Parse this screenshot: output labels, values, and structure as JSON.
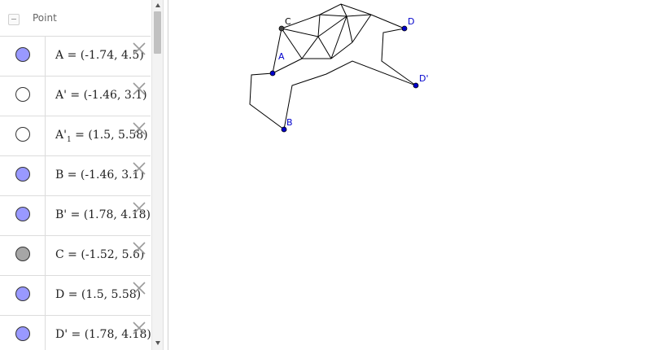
{
  "algebra": {
    "group_title": "Point",
    "items": [
      {
        "name": "A",
        "value": "= (-1.74, 4.5)",
        "color": "#9999ff"
      },
      {
        "name": "A'",
        "value": "= (-1.46, 3.1)",
        "color": "#ffffff"
      },
      {
        "name": "A'",
        "sub": "1",
        "value": "= (1.5, 5.58)",
        "color": "#ffffff"
      },
      {
        "name": "B",
        "value": "= (-1.46, 3.1)",
        "color": "#9999ff"
      },
      {
        "name": "B'",
        "value": "= (1.78, 4.18)",
        "color": "#9999ff"
      },
      {
        "name": "C",
        "value": "= (-1.52, 5.6)",
        "color": "#a6a6a6"
      },
      {
        "name": "D",
        "value": "= (1.5, 5.58)",
        "color": "#9999ff"
      },
      {
        "name": "D'",
        "value": "= (1.78, 4.18)",
        "color": "#9999ff"
      }
    ]
  },
  "graphics": {
    "point_color": "#0000cc",
    "label_color": "#0000cc",
    "labels": {
      "C": "C",
      "A": "A",
      "B": "B",
      "D": "D",
      "Dp": "D'"
    }
  },
  "icons": {
    "collapse": "minus-icon",
    "delete": "close-icon"
  }
}
